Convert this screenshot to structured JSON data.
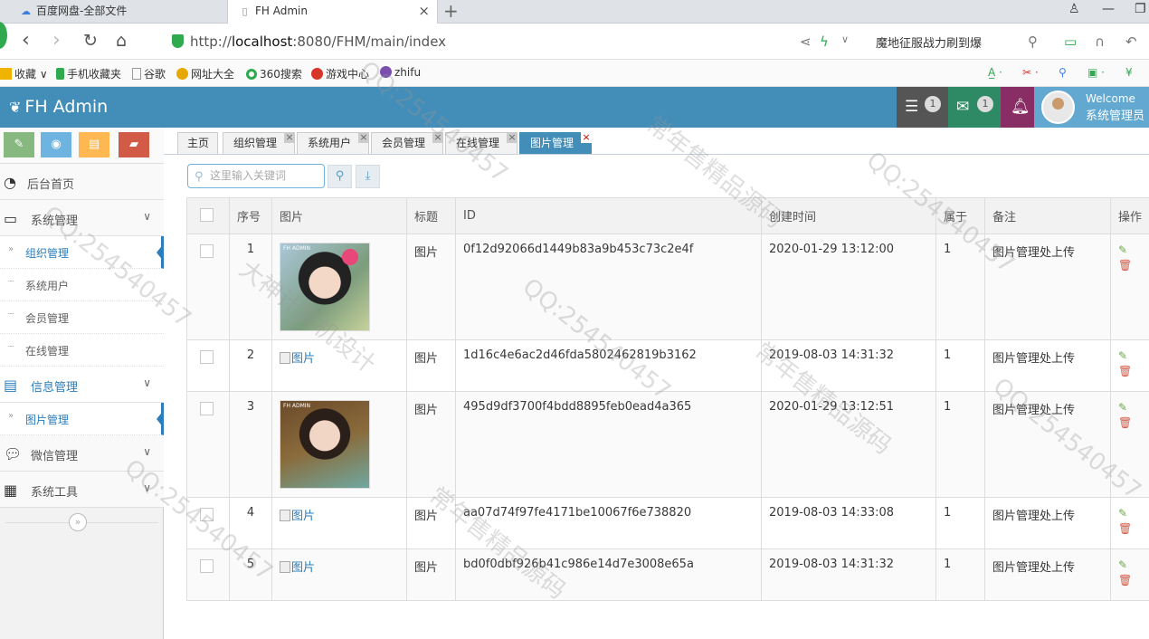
{
  "browser": {
    "tabs": [
      {
        "title": "百度网盘-全部文件"
      },
      {
        "title": "FH Admin"
      }
    ],
    "url_scheme": "http://",
    "url_host": "localhost",
    "url_rest": ":8080/FHM/main/index",
    "search_text": "魔地征服战力刷到爆",
    "bookmarks": [
      "收藏",
      "手机收藏夹",
      "谷歌",
      "网址大全",
      "360搜索",
      "游戏中心",
      "zhifu"
    ]
  },
  "app": {
    "brand": "FH Admin",
    "header": {
      "tasks_badge": "1",
      "messages_badge": "1",
      "welcome": "Welcome",
      "username": "系统管理员"
    },
    "accent": "#438eb9"
  },
  "sidebar": {
    "menu": [
      {
        "label": "后台首页",
        "icon": "dashboard-icon"
      },
      {
        "label": "系统管理",
        "icon": "desktop-icon"
      },
      {
        "label": "信息管理",
        "icon": "list-icon"
      },
      {
        "label": "微信管理",
        "icon": "comments-icon"
      },
      {
        "label": "系统工具",
        "icon": "th-icon"
      }
    ],
    "sys_sub": [
      "组织管理",
      "系统用户",
      "会员管理",
      "在线管理"
    ],
    "info_sub": [
      "图片管理"
    ]
  },
  "content": {
    "tabs": [
      "主页",
      "组织管理",
      "系统用户",
      "会员管理",
      "在线管理",
      "图片管理"
    ],
    "search_placeholder": "这里输入关键词",
    "columns": [
      "序号",
      "图片",
      "标题",
      "ID",
      "创建时间",
      "属于",
      "备注",
      "操作"
    ],
    "rows": [
      {
        "no": "1",
        "img": "photo",
        "title": "图片",
        "id": "0f12d92066d1449b83a9b453c73c2e4f",
        "created": "2020-01-29 13:12:00",
        "belong": "1",
        "note": "图片管理处上传"
      },
      {
        "no": "2",
        "img": "图片",
        "title": "图片",
        "id": "1d16c4e6ac2d46fda5802462819b3162",
        "created": "2019-08-03 14:31:32",
        "belong": "1",
        "note": "图片管理处上传"
      },
      {
        "no": "3",
        "img": "photo",
        "title": "图片",
        "id": "495d9df3700f4bdd8895feb0ead4a365",
        "created": "2020-01-29 13:12:51",
        "belong": "1",
        "note": "图片管理处上传"
      },
      {
        "no": "4",
        "img": "图片",
        "title": "图片",
        "id": "aa07d74f97fe4171be10067f6e738820",
        "created": "2019-08-03 14:33:08",
        "belong": "1",
        "note": "图片管理处上传"
      },
      {
        "no": "5",
        "img": "图片",
        "title": "图片",
        "id": "bd0f0dbf926b41c986e14d7e3008e65a",
        "created": "2019-08-03 14:31:32",
        "belong": "1",
        "note": "图片管理处上传"
      }
    ]
  },
  "watermarks": [
    "QQ:254540457",
    "常年售精品源码",
    "大神计算机设计"
  ]
}
